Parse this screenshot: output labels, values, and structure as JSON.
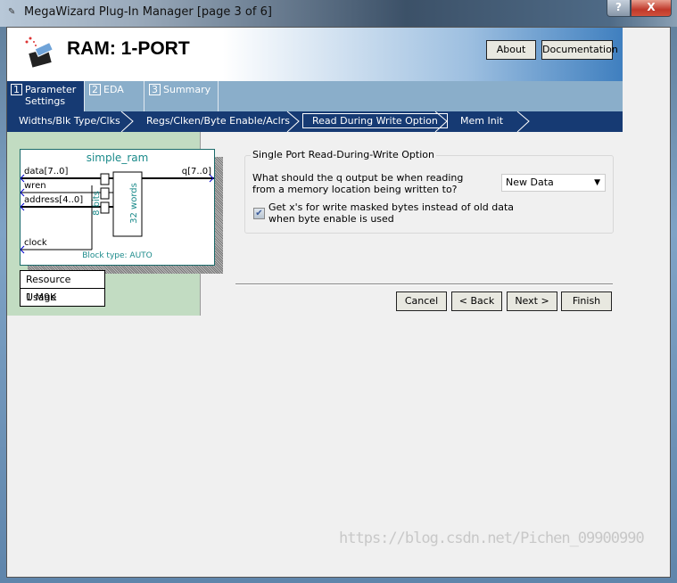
{
  "window": {
    "title": "MegaWizard Plug-In Manager [page 3 of 6]",
    "help": "?",
    "close": "X"
  },
  "header": {
    "title": "RAM: 1-PORT",
    "about": "About",
    "documentation": "Documentation"
  },
  "tabs": [
    {
      "num": "1",
      "label": "Parameter Settings"
    },
    {
      "num": "2",
      "label": "EDA"
    },
    {
      "num": "3",
      "label": "Summary"
    }
  ],
  "nav": [
    "Widths/Blk Type/Clks",
    "Regs/Clken/Byte Enable/Aclrs",
    "Read During Write Option",
    "Mem Init"
  ],
  "symbol": {
    "name": "simple_ram",
    "ports_in": [
      "data[7..0]",
      "wren",
      "address[4..0]",
      "clock"
    ],
    "port_out": "q[7..0]",
    "bits": "8 bits",
    "words": "32 words",
    "block_type": "Block type: AUTO"
  },
  "resource": {
    "header": "Resource Usage",
    "value": "1 M9K"
  },
  "option": {
    "group": "Single Port Read-During-Write Option",
    "question": "What should the q output be when reading from a memory location being written to?",
    "selected": "New Data",
    "checkbox_label": "Get x's for write masked bytes instead of old data when byte enable is used",
    "checkbox_checked": true
  },
  "buttons": {
    "cancel": "Cancel",
    "back": "< Back",
    "next": "Next >",
    "finish": "Finish"
  },
  "watermark": "https://blog.csdn.net/Pichen_09900990"
}
